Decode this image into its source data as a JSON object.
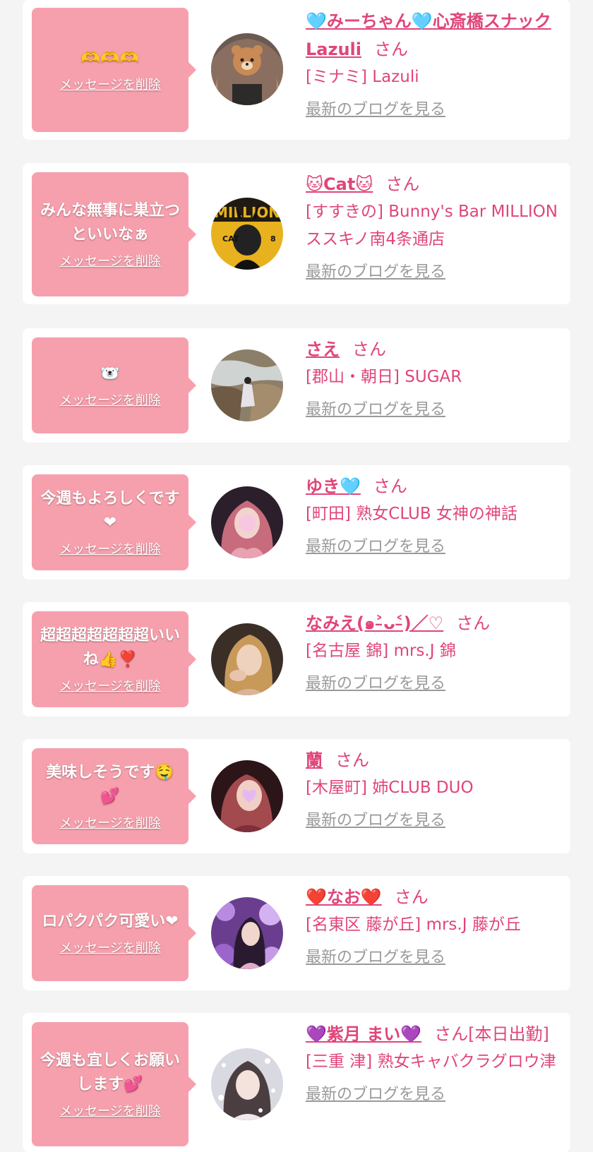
{
  "delete_label": "メッセージを削除",
  "honorific": "さん",
  "blog_label": "最新のブログを見る",
  "colors": {
    "accent": "#e0457a",
    "bubble": "#f7a0ad",
    "card": "#ffffff",
    "page": "#f4f4f4",
    "link_gray": "#9a9a9a"
  },
  "cards": [
    {
      "message": "🫶🫶🫶",
      "name": "🩵みーちゃん🩵心斎橋スナックLazuli",
      "status": "",
      "shop": "[ミナミ] Lazuli",
      "avatar_icon": "bear-face-avatar"
    },
    {
      "message": "みんな無事に巣立つといいなぁ",
      "name": "🐱Cat🐱",
      "status": "",
      "shop": "[すすきの] Bunny's Bar MILLION ススキノ南4条通店",
      "avatar_icon": "bunny-magazine-avatar"
    },
    {
      "message": "🐻‍❄️",
      "name": "さえ",
      "status": "",
      "shop": "[郡山・朝日] SUGAR",
      "avatar_icon": "rocks-river-avatar"
    },
    {
      "message": "今週もよろしくです❤",
      "name": "ゆき🩵",
      "status": "",
      "shop": "[町田] 熟女CLUB 女神の神話",
      "avatar_icon": "pink-hair-avatar"
    },
    {
      "message": "超超超超超超超いいね👍❣️",
      "name": "なみえ(๑˃̵ᴗ˂̵)／♡",
      "status": "",
      "shop": "[名古屋 錦] mrs.J 錦",
      "avatar_icon": "blonde-woman-avatar"
    },
    {
      "message": "美味しそうです🤤💕",
      "name": "蘭",
      "status": "",
      "shop": "[木屋町] 姉CLUB DUO",
      "avatar_icon": "heart-face-avatar"
    },
    {
      "message": "ロパクパク可愛い❤",
      "name": "❤️なお❤️",
      "status": "",
      "shop": "[名東区 藤が丘] mrs.J 藤が丘",
      "avatar_icon": "purple-flowers-avatar"
    },
    {
      "message": "今週も宜しくお願いします💕",
      "name": "💜紫月 まい💜",
      "status": "[本日出勤]",
      "shop": "[三重 津] 熟女キャバクラグロウ津",
      "avatar_icon": "sparkle-woman-avatar"
    }
  ]
}
